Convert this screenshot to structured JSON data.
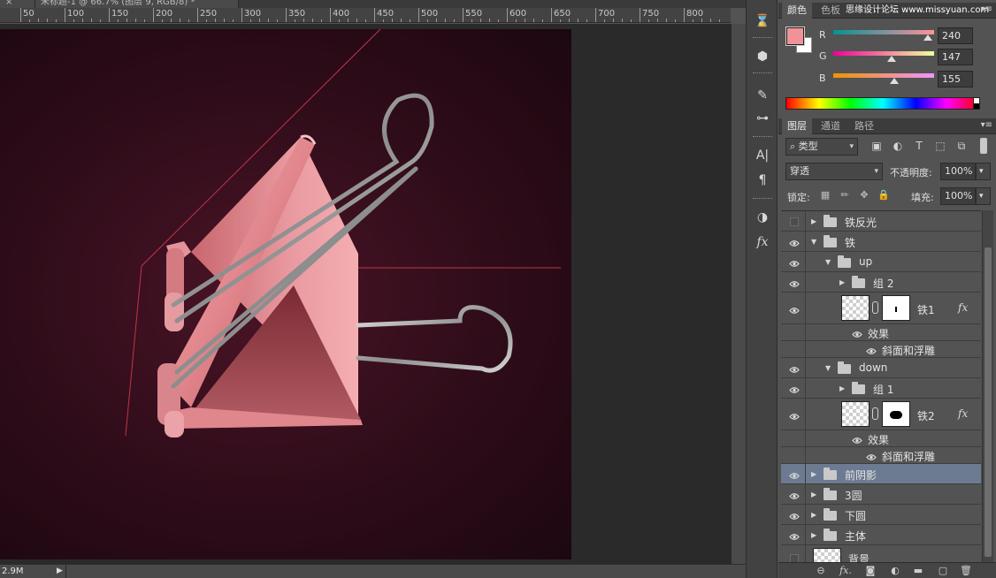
{
  "document_tab": {
    "title": "未标题-1 @ 66.7% (图层 9, RGB/8) *",
    "prev_tab_close": "×"
  },
  "ruler": {
    "labels": [
      "50",
      "100",
      "150",
      "200",
      "250",
      "300",
      "350",
      "400",
      "450",
      "500",
      "550",
      "600",
      "650",
      "700",
      "750",
      "800"
    ]
  },
  "status": {
    "doc_size": "2.9M",
    "arrow": "▶"
  },
  "dock": {
    "icons": [
      "history-icon",
      "3d-icon",
      "brush-presets-icon",
      "adjustments-icon",
      "character-icon",
      "paragraph-icon",
      "styles-icon",
      "fx-icon"
    ],
    "labels": {
      "history": "⌛",
      "threed": "⬢",
      "brush": "✎",
      "adjust": "⊶",
      "character": "A|",
      "paragraph": "¶",
      "styles": "◑",
      "fx": "fx"
    }
  },
  "color_panel": {
    "tabs": [
      "颜色",
      "色板"
    ],
    "watermark": "思缘设计论坛 www.missyuan.com",
    "menu": "▾≡",
    "foreground": "#f09399",
    "background": "#ffffff",
    "channels": [
      {
        "label": "R",
        "value": "240",
        "fraction": 0.941,
        "gradient": "linear-gradient(to right, #009399, #ff9399)"
      },
      {
        "label": "G",
        "value": "147",
        "fraction": 0.576,
        "gradient": "linear-gradient(to right, #f0009b, #f0ff9b)"
      },
      {
        "label": "B",
        "value": "155",
        "fraction": 0.608,
        "gradient": "linear-gradient(to right, #f09300, #f093ff)"
      }
    ]
  },
  "layers_panel": {
    "tabs": [
      "图层",
      "通道",
      "路径"
    ],
    "menu": "▾≡",
    "filter_kind": "⌕ 类型",
    "blend_mode": "穿透",
    "opacity_label": "不透明度:",
    "opacity_value": "100%",
    "lock_label": "锁定:",
    "fill_label": "填充:",
    "fill_value": "100%",
    "filter_icons": {
      "pixel": "▣",
      "adjust": "◐",
      "type": "T",
      "shape": "⬚",
      "smart": "⧉"
    },
    "lock_icons": {
      "transparent": "▦",
      "paint": "✏",
      "move": "✥",
      "all": "🔒"
    },
    "dropdown_arrow": "▾",
    "footer_icons": {
      "link": "⊖",
      "fx": "fx.",
      "mask": "◙",
      "adjust": "◐",
      "group": "▬",
      "new": "▢",
      "delete": "🗑"
    },
    "layers": [
      {
        "name": "铁反光",
        "kind": "group",
        "indent": 0,
        "expanded": false,
        "visible": false
      },
      {
        "name": "铁",
        "kind": "group",
        "indent": 0,
        "expanded": true,
        "visible": true
      },
      {
        "name": "up",
        "kind": "group",
        "indent": 1,
        "expanded": true,
        "visible": true
      },
      {
        "name": "组 2",
        "kind": "group",
        "indent": 2,
        "expanded": false,
        "visible": true
      },
      {
        "name": "铁1",
        "kind": "shape",
        "indent": 2,
        "visible": true,
        "fx": "fx"
      },
      {
        "name": "效果",
        "kind": "effects",
        "indent": 3,
        "visible": true
      },
      {
        "name": "斜面和浮雕",
        "kind": "effect",
        "indent": 4,
        "visible": true
      },
      {
        "name": "down",
        "kind": "group",
        "indent": 1,
        "expanded": true,
        "visible": true
      },
      {
        "name": "组 1",
        "kind": "group",
        "indent": 2,
        "expanded": false,
        "visible": true
      },
      {
        "name": "铁2",
        "kind": "shape",
        "indent": 2,
        "visible": true,
        "fx": "fx"
      },
      {
        "name": "效果",
        "kind": "effects",
        "indent": 3,
        "visible": true
      },
      {
        "name": "斜面和浮雕",
        "kind": "effect",
        "indent": 4,
        "visible": true
      },
      {
        "name": "前阴影",
        "kind": "group",
        "indent": 0,
        "expanded": false,
        "visible": true,
        "selected": true
      },
      {
        "name": "3圆",
        "kind": "group",
        "indent": 0,
        "expanded": false,
        "visible": true
      },
      {
        "name": "下圆",
        "kind": "group",
        "indent": 0,
        "expanded": false,
        "visible": true
      },
      {
        "name": "主体",
        "kind": "group",
        "indent": 0,
        "expanded": false,
        "visible": true
      },
      {
        "name": "背景",
        "kind": "pixel",
        "indent": 0,
        "visible": false
      }
    ]
  },
  "colors": {
    "clip_light": "#f3a5a9",
    "clip_mid": "#d97a80",
    "clip_dark": "#a94c55",
    "guide_line": "#c0354a"
  }
}
